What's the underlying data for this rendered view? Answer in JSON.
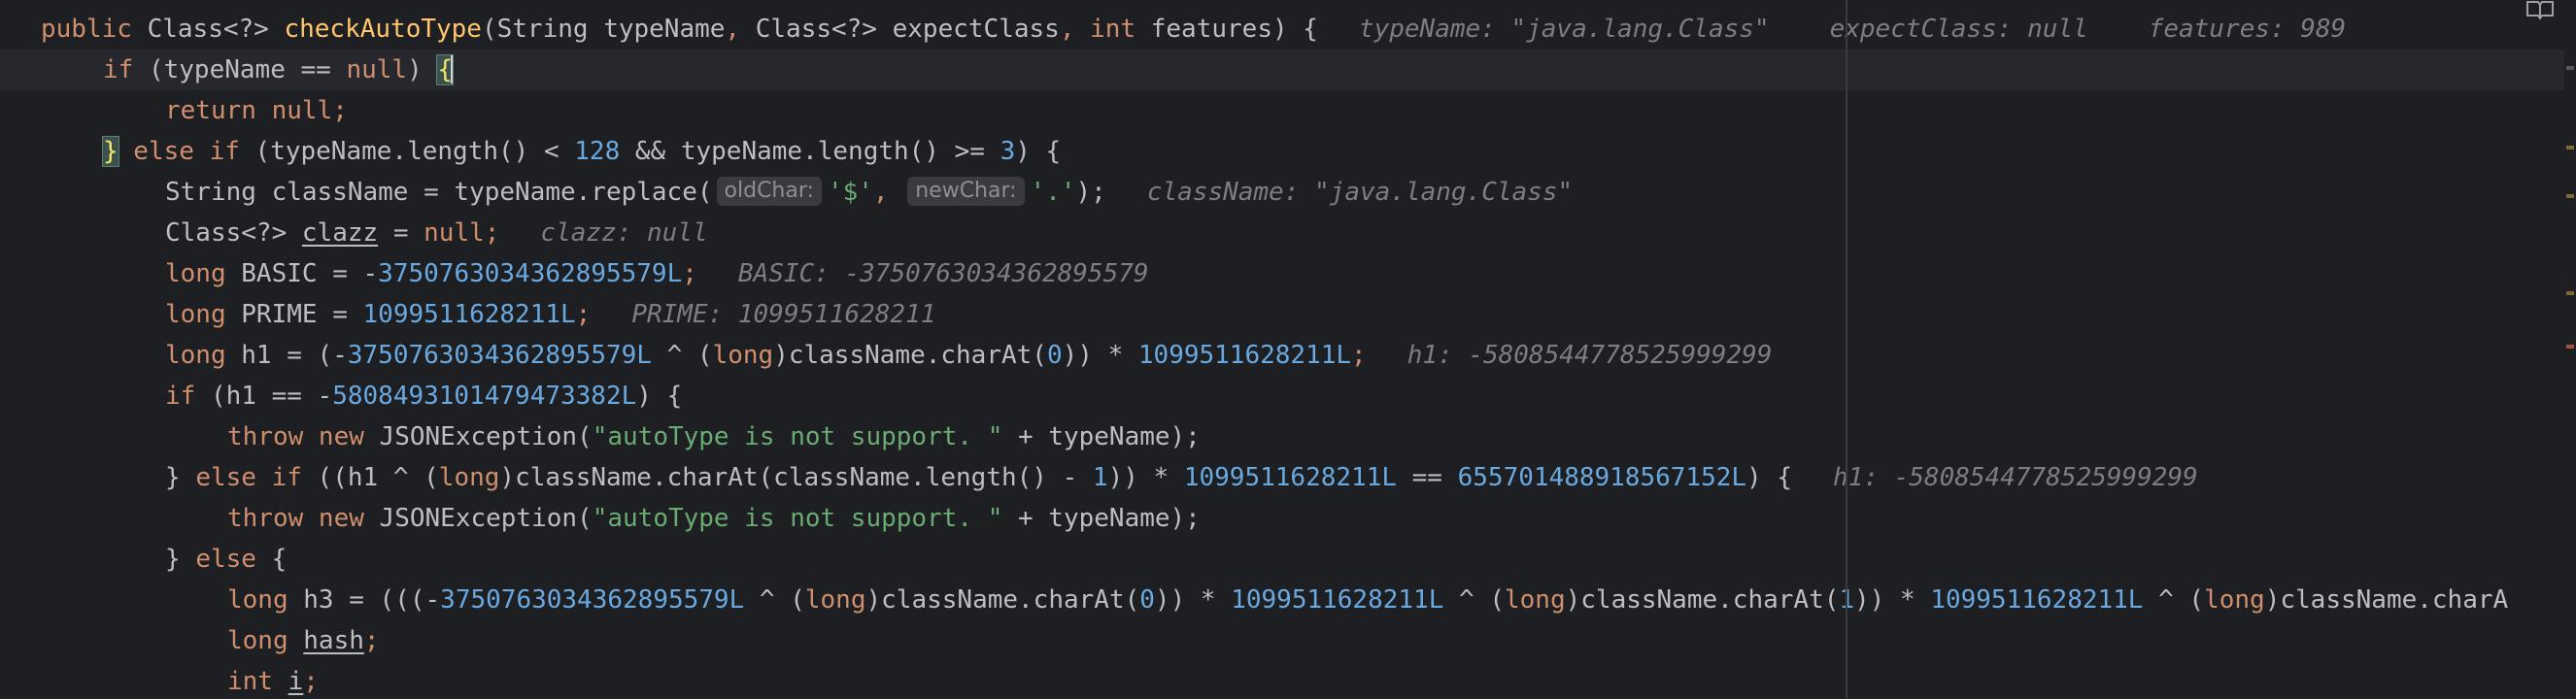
{
  "editor": {
    "code": {
      "l1": {
        "kw_public": "public ",
        "t_class": "Class<?> ",
        "fn_name": "checkAutoType",
        "p_open": "(String typeName",
        "comma1": ", ",
        "t_class2": "Class<?> expectClass",
        "comma2": ", ",
        "kw_int": "int",
        "p_features": " features) {",
        "hint_typename": "typeName: \"java.lang.Class\"",
        "hint_expect": "expectClass: null",
        "hint_features": "features: 989"
      },
      "l2": {
        "kw_if": "if",
        "cond_a": " (typeName == ",
        "kw_null": "null",
        "cond_b": ") ",
        "brace": "{"
      },
      "l3": {
        "kw_return": "return ",
        "kw_null": "null",
        "semi": ";"
      },
      "l4": {
        "brace": "}",
        "kw_else": " else ",
        "kw_if": "if",
        "a": " (typeName.length() < ",
        "n128": "128",
        "b": " && typeName.length() >= ",
        "n3": "3",
        "c": ") {"
      },
      "l5": {
        "a": "String className = typeName.replace(",
        "hint_old": "oldChar:",
        "s1": "'$'",
        "comma": ", ",
        "hint_new": "newChar:",
        "s2": "'.'",
        "b": ");",
        "hint_classname": "className: \"java.lang.Class\""
      },
      "l6": {
        "a": "Class<?> ",
        "var": "clazz",
        "b": " = ",
        "kw_null": "null",
        "c": ";",
        "hint": "clazz: null"
      },
      "l7": {
        "kw_long": "long",
        "a": " BASIC = -",
        "num": "3750763034362895579L",
        "b": ";",
        "hint": "BASIC: -3750763034362895579"
      },
      "l8": {
        "kw_long": "long",
        "a": " PRIME = ",
        "num": "1099511628211L",
        "b": ";",
        "hint": "PRIME: 1099511628211"
      },
      "l9": {
        "kw_long": "long",
        "a": " h1 = (-",
        "num1": "3750763034362895579L",
        "b": " ^ (",
        "kw_long2": "long",
        "c": ")className.charAt(",
        "n0": "0",
        "d": ")) * ",
        "num2": "1099511628211L",
        "e": ";",
        "hint": "h1: -5808544778525999299"
      },
      "l10": {
        "kw_if": "if",
        "a": " (h1 == -",
        "num": "5808493101479473382L",
        "b": ") {"
      },
      "l11": {
        "kw_throw": "throw ",
        "kw_new": "new ",
        "a": "JSONException(",
        "str": "\"autoType is not support. \"",
        "b": " + typeName);"
      },
      "l12": {
        "a": "} ",
        "kw_else": "else ",
        "kw_if": "if",
        "b": " ((h1 ^ (",
        "kw_long": "long",
        "c": ")className.charAt(className.length() - ",
        "n1": "1",
        "d": ")) * ",
        "num1": "1099511628211L",
        "e": " == ",
        "num2": "655701488918567152L",
        "f": ") {",
        "hint": "h1: -5808544778525999299"
      },
      "l13": {
        "kw_throw": "throw ",
        "kw_new": "new ",
        "a": "JSONException(",
        "str": "\"autoType is not support. \"",
        "b": " + typeName);"
      },
      "l14": {
        "a": "} ",
        "kw_else": "else",
        "b": " {"
      },
      "l15": {
        "kw_long": "long",
        "a": " h3 = (((-",
        "num1": "3750763034362895579L",
        "b": " ^ (",
        "kw_long2": "long",
        "c": ")className.charAt(",
        "n0": "0",
        "d": ")) * ",
        "num2": "1099511628211L",
        "e": " ^ (",
        "kw_long3": "long",
        "f": ")className.charAt(",
        "n1": "1",
        "g": ")) * ",
        "num3": "1099511628211L",
        "h": " ^ (",
        "kw_long4": "long",
        "i": ")className.charA"
      },
      "l16": {
        "kw_long": "long ",
        "var": "hash",
        "semi": ";"
      },
      "l17": {
        "kw_int": "int ",
        "var": "i",
        "semi": ";"
      }
    },
    "colors": {
      "background": "#1e1f22",
      "keyword": "#cf8e6d",
      "function": "#ffc66d",
      "number": "#6aa9e0",
      "string": "#6aab73",
      "hint": "#7a7e85"
    }
  }
}
